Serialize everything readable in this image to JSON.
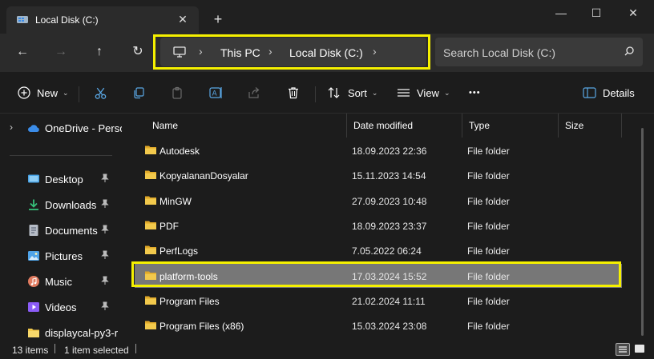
{
  "window": {
    "tab_title": "Local Disk (C:)",
    "tab_close": "✕",
    "new_tab": "+",
    "minimize": "—",
    "maximize": "☐",
    "close": "✕"
  },
  "nav": {
    "back": "←",
    "forward": "→",
    "up": "↑",
    "refresh": "↻"
  },
  "breadcrumb": {
    "sep": "›",
    "items": [
      "This PC",
      "Local Disk (C:)"
    ]
  },
  "search": {
    "placeholder": "Search Local Disk (C:)"
  },
  "commands": {
    "new": "New",
    "sort": "Sort",
    "view": "View",
    "more": "•••",
    "details": "Details",
    "chevron": "⌄"
  },
  "sidebar": {
    "items": [
      {
        "label": "OneDrive - Perso",
        "icon": "cloud-icon",
        "color": "#3b8ce8"
      },
      {
        "label": "Desktop",
        "icon": "desktop-icon",
        "color": "#4aa4e6"
      },
      {
        "label": "Downloads",
        "icon": "download-icon",
        "color": "#36c07a"
      },
      {
        "label": "Documents",
        "icon": "document-icon",
        "color": "#b6bcc6"
      },
      {
        "label": "Pictures",
        "icon": "pictures-icon",
        "color": "#4fa3e8"
      },
      {
        "label": "Music",
        "icon": "music-icon",
        "color": "#e07a5f"
      },
      {
        "label": "Videos",
        "icon": "videos-icon",
        "color": "#8b5cf6"
      },
      {
        "label": "displaycal-py3-r",
        "icon": "folder-icon",
        "color": "#f2c94c"
      }
    ]
  },
  "columns": {
    "name": "Name",
    "date": "Date modified",
    "type": "Type",
    "size": "Size",
    "sort_indicator": "^"
  },
  "files": [
    {
      "name": "Autodesk",
      "date": "18.09.2023 22:36",
      "type": "File folder"
    },
    {
      "name": "KopyalananDosyalar",
      "date": "15.11.2023 14:54",
      "type": "File folder"
    },
    {
      "name": "MinGW",
      "date": "27.09.2023 10:48",
      "type": "File folder"
    },
    {
      "name": "PDF",
      "date": "18.09.2023 23:37",
      "type": "File folder"
    },
    {
      "name": "PerfLogs",
      "date": "7.05.2022 06:24",
      "type": "File folder"
    },
    {
      "name": "platform-tools",
      "date": "17.03.2024 15:52",
      "type": "File folder"
    },
    {
      "name": "Program Files",
      "date": "21.02.2024 11:11",
      "type": "File folder"
    },
    {
      "name": "Program Files (x86)",
      "date": "15.03.2024 23:08",
      "type": "File folder"
    }
  ],
  "status": {
    "count": "13 items",
    "selected": "1 item selected"
  },
  "colors": {
    "background": "#1c1c1c",
    "highlight": "#f5f000",
    "selection": "#777777",
    "folder": "#f2c94c"
  }
}
